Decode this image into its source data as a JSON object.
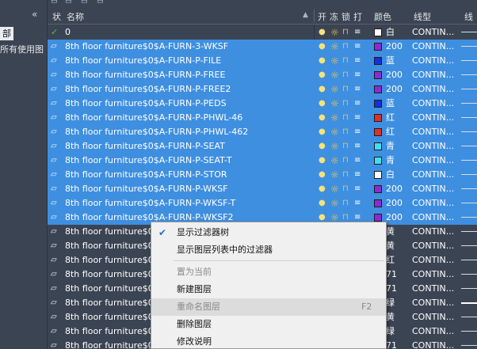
{
  "left_panel": {
    "collapse_glyph": "«",
    "filter_all": "部",
    "filter_used": "所有使用图"
  },
  "header": {
    "status": "状",
    "name": "名称",
    "on": "开",
    "freeze": "冻",
    "lock": "锁",
    "plot": "打",
    "color": "颜色",
    "linetype": "线型",
    "lineweight": "线"
  },
  "rows": [
    {
      "status": "✓",
      "name": "0",
      "color_name": "白",
      "swatch": "#ffffff",
      "linetype": "CONTIN...",
      "selected": false,
      "thick": false
    },
    {
      "status": "▱",
      "name": "8th floor furniture$0$A-FURN-3-WKSF",
      "color_name": "200",
      "swatch": "#8a2bd6",
      "linetype": "CONTIN...",
      "selected": true,
      "thick": false
    },
    {
      "status": "▱",
      "name": "8th floor furniture$0$A-FURN-P-FILE",
      "color_name": "蓝",
      "swatch": "#1530d8",
      "linetype": "CONTIN...",
      "selected": true,
      "thick": false
    },
    {
      "status": "▱",
      "name": "8th floor furniture$0$A-FURN-P-FREE",
      "color_name": "200",
      "swatch": "#8a2bd6",
      "linetype": "CONTIN...",
      "selected": true,
      "thick": false
    },
    {
      "status": "▱",
      "name": "8th floor furniture$0$A-FURN-P-FREE2",
      "color_name": "200",
      "swatch": "#8a2bd6",
      "linetype": "CONTIN...",
      "selected": true,
      "thick": false
    },
    {
      "status": "▱",
      "name": "8th floor furniture$0$A-FURN-P-PEDS",
      "color_name": "蓝",
      "swatch": "#1530d8",
      "linetype": "CONTIN...",
      "selected": true,
      "thick": false
    },
    {
      "status": "▱",
      "name": "8th floor furniture$0$A-FURN-P-PHWL-46",
      "color_name": "红",
      "swatch": "#e0302a",
      "linetype": "CONTIN...",
      "selected": true,
      "thick": false
    },
    {
      "status": "▱",
      "name": "8th floor furniture$0$A-FURN-P-PHWL-462",
      "color_name": "红",
      "swatch": "#e0302a",
      "linetype": "CONTIN...",
      "selected": true,
      "thick": false
    },
    {
      "status": "▱",
      "name": "8th floor furniture$0$A-FURN-P-SEAT",
      "color_name": "青",
      "swatch": "#3ee0f0",
      "linetype": "CONTIN...",
      "selected": true,
      "thick": false
    },
    {
      "status": "▱",
      "name": "8th floor furniture$0$A-FURN-P-SEAT-T",
      "color_name": "青",
      "swatch": "#3ee0f0",
      "linetype": "CONTIN...",
      "selected": true,
      "thick": false
    },
    {
      "status": "▱",
      "name": "8th floor furniture$0$A-FURN-P-STOR",
      "color_name": "白",
      "swatch": "#ffffff",
      "linetype": "CONTIN...",
      "selected": true,
      "thick": false
    },
    {
      "status": "▱",
      "name": "8th floor furniture$0$A-FURN-P-WKSF",
      "color_name": "200",
      "swatch": "#8a2bd6",
      "linetype": "CONTIN...",
      "selected": true,
      "thick": false
    },
    {
      "status": "▱",
      "name": "8th floor furniture$0$A-FURN-P-WKSF-T",
      "color_name": "200",
      "swatch": "#8a2bd6",
      "linetype": "CONTIN...",
      "selected": true,
      "thick": false
    },
    {
      "status": "▱",
      "name": "8th floor furniture$0$A-FURN-P-WKSF2",
      "color_name": "200",
      "swatch": "#8a2bd6",
      "linetype": "CONTIN...",
      "selected": true,
      "thick": false
    },
    {
      "status": "▱",
      "name": "8th floor furniture$0",
      "color_name": "黄",
      "swatch": "#f2e23a",
      "linetype": "CONTIN...",
      "selected": false,
      "thick": false
    },
    {
      "status": "▱",
      "name": "8th floor furniture$0",
      "color_name": "黄",
      "swatch": "#f2e23a",
      "linetype": "CONTIN...",
      "selected": false,
      "thick": false
    },
    {
      "status": "▱",
      "name": "8th floor furniture$0",
      "color_name": "红",
      "swatch": "#e0302a",
      "linetype": "CONTIN...",
      "selected": false,
      "thick": false
    },
    {
      "status": "▱",
      "name": "8th floor furniture$0",
      "color_name": "71",
      "swatch": "#6fb84a",
      "linetype": "CONTIN...",
      "selected": false,
      "thick": false
    },
    {
      "status": "▱",
      "name": "8th floor furniture$0",
      "color_name": "71",
      "swatch": "#6fb84a",
      "linetype": "CONTIN...",
      "selected": false,
      "thick": false
    },
    {
      "status": "▱",
      "name": "8th floor furniture$0",
      "color_name": "绿",
      "swatch": "#2bd43a",
      "linetype": "CONTIN...",
      "selected": false,
      "thick": true
    },
    {
      "status": "▱",
      "name": "8th floor furniture$0",
      "color_name": "黄",
      "swatch": "#f2e23a",
      "linetype": "CONTIN...",
      "selected": false,
      "thick": false
    },
    {
      "status": "▱",
      "name": "8th floor furniture$0",
      "color_name": "绿",
      "swatch": "#2bd43a",
      "linetype": "CONTIN...",
      "selected": false,
      "thick": false
    },
    {
      "status": "▱",
      "name": "8th floor furniture$0",
      "color_name": "71",
      "swatch": "#6fb84a",
      "linetype": "CONTIN...",
      "selected": false,
      "thick": false
    }
  ],
  "context_menu": {
    "items": [
      {
        "label": "显示过滤器树",
        "shortcut": "",
        "checked": true,
        "disabled": false,
        "highlighted": false
      },
      {
        "label": "显示图层列表中的过滤器",
        "shortcut": "",
        "checked": false,
        "disabled": false,
        "highlighted": false
      },
      {
        "label": "置为当前",
        "shortcut": "",
        "checked": false,
        "disabled": true,
        "highlighted": false
      },
      {
        "label": "新建图层",
        "shortcut": "",
        "checked": false,
        "disabled": false,
        "highlighted": false
      },
      {
        "label": "重命名图层",
        "shortcut": "F2",
        "checked": false,
        "disabled": true,
        "highlighted": true
      },
      {
        "label": "删除图层",
        "shortcut": "",
        "checked": false,
        "disabled": false,
        "highlighted": false
      },
      {
        "label": "修改说明",
        "shortcut": "",
        "checked": false,
        "disabled": false,
        "highlighted": false
      }
    ]
  },
  "colors": {
    "selection": "#3f8fe0",
    "panel_bg": "#3b4453",
    "menu_bg": "#f0f0f0"
  }
}
